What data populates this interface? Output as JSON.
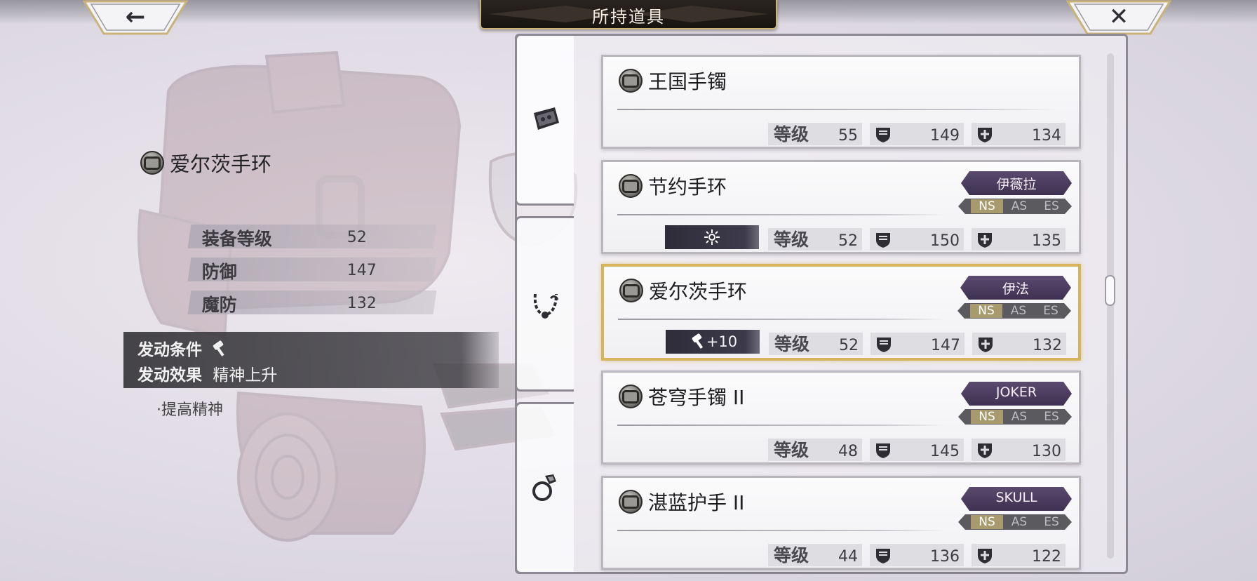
{
  "header": {
    "title": "所持道具",
    "back_glyph": "←",
    "close_glyph": "✕"
  },
  "detail": {
    "name": "爱尔茨手环",
    "icon": "bracelet-icon",
    "stats": [
      {
        "label": "装备等级",
        "value": "52"
      },
      {
        "label": "防御",
        "value": "147"
      },
      {
        "label": "魔防",
        "value": "132"
      }
    ],
    "trigger_label": "发动条件",
    "trigger_icon": "hammer-icon",
    "effect_label": "发动效果",
    "effect_value": "精神上升",
    "description": "·提高精神"
  },
  "category_tabs": [
    {
      "icon": "bracelet-category-icon",
      "active": true
    },
    {
      "icon": "necklace-category-icon",
      "active": false
    },
    {
      "icon": "ring-category-icon",
      "active": false
    }
  ],
  "items": [
    {
      "name": "王国手镯",
      "level_label": "等级",
      "level": "55",
      "def": "149",
      "mdef": "134",
      "owner": null,
      "skill": null,
      "selected": false
    },
    {
      "name": "节约手环",
      "level_label": "等级",
      "level": "52",
      "def": "150",
      "mdef": "135",
      "owner": "伊薇拉",
      "skill": "sparkle",
      "skill_text": "",
      "selected": false
    },
    {
      "name": "爱尔茨手环",
      "level_label": "等级",
      "level": "52",
      "def": "147",
      "mdef": "132",
      "owner": "伊法",
      "skill": "hammer",
      "skill_text": "+10",
      "selected": true
    },
    {
      "name": "苍穹手镯 II",
      "level_label": "等级",
      "level": "48",
      "def": "145",
      "mdef": "130",
      "owner": "JOKER",
      "skill": null,
      "selected": false
    },
    {
      "name": "湛蓝护手 II",
      "level_label": "等级",
      "level": "44",
      "def": "136",
      "mdef": "122",
      "owner": "SKULL",
      "skill": null,
      "selected": false
    }
  ],
  "modes": [
    "NS",
    "AS",
    "ES"
  ],
  "active_mode": "NS",
  "colors": {
    "accent_gold": "#d6b45c",
    "owner_badge": "#4a3b5e",
    "panel_dark": "#37363a"
  }
}
